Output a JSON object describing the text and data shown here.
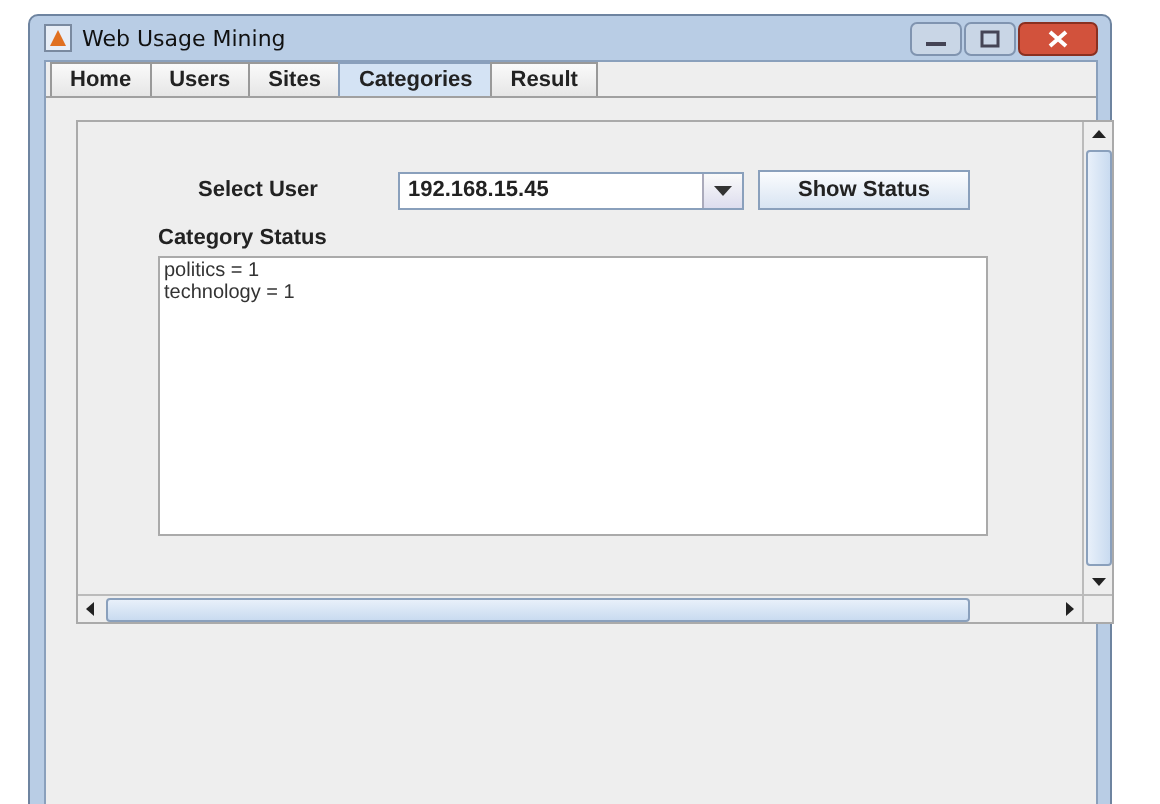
{
  "window": {
    "title": "Web Usage Mining"
  },
  "tabs": [
    {
      "label": "Home",
      "selected": false
    },
    {
      "label": "Users",
      "selected": false
    },
    {
      "label": "Sites",
      "selected": false
    },
    {
      "label": "Categories",
      "selected": true
    },
    {
      "label": "Result",
      "selected": false
    }
  ],
  "select_user": {
    "label": "Select User",
    "value": "192.168.15.45"
  },
  "show_button": "Show Status",
  "category_status": {
    "label": "Category Status",
    "lines": [
      "politics = 1",
      "technology = 1"
    ]
  }
}
